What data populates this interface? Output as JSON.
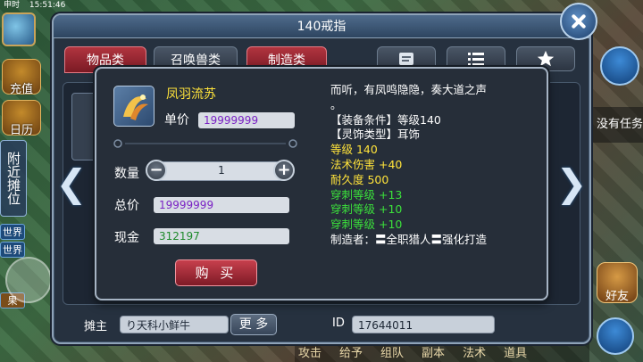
{
  "status_bar": {
    "server": "申时",
    "time": "15:51:46"
  },
  "hud": {
    "recharge_label": "充值",
    "calendar_label": "日历",
    "nearby_stall_label": "附近摊位",
    "world_chat": [
      "世界",
      "世界",
      "果"
    ],
    "task_label": "没有任务",
    "friend_label": "好友",
    "bottom_menu": [
      "攻击",
      "给予",
      "组队",
      "副本",
      "法术",
      "道具"
    ]
  },
  "window": {
    "title": "140戒指",
    "tabs": [
      "物品类",
      "召唤兽类",
      "制造类"
    ],
    "seller_label": "摊主",
    "seller_name": "り天科小鲜牛",
    "more_label": "更 多",
    "id_label": "ID",
    "id_value": "17644011"
  },
  "popup": {
    "item_name": "凤羽流苏",
    "unit_price_label": "单价",
    "unit_price": "19999999",
    "quantity_label": "数量",
    "quantity": "1",
    "minus_symbol": "−",
    "plus_symbol": "+",
    "total_label": "总价",
    "total_price": "19999999",
    "cash_label": "现金",
    "cash": "312197",
    "buy_label": "购 买",
    "description_line1": "而听，有凤鸣隐隐，奏大道之声",
    "description_line2": "。",
    "equip_condition": "【装备条件】等级140",
    "ornament_type": "【灵饰类型】耳饰",
    "level_line": "等级 140",
    "magic_damage": "法术伤害 +40",
    "durability": "耐久度 500",
    "pierce1": "穿刺等级 +13",
    "pierce2": "穿刺等级 +10",
    "pierce3": "穿刺等级 +10",
    "maker": "制造者：〓全职猎人〓强化打造"
  },
  "icons": {
    "close": "close-icon",
    "left_arrow": "chevron-left-icon",
    "right_arrow": "chevron-right-icon",
    "tab_icons": [
      "scroll-icon",
      "list-icon",
      "star-icon"
    ]
  },
  "colors": {
    "item_name": "#ffe33a",
    "unit_price_text": "#7a22c4",
    "cash_text": "#1f8a2c",
    "green_stat": "#3be03b",
    "tab_red": "#b1343f"
  }
}
